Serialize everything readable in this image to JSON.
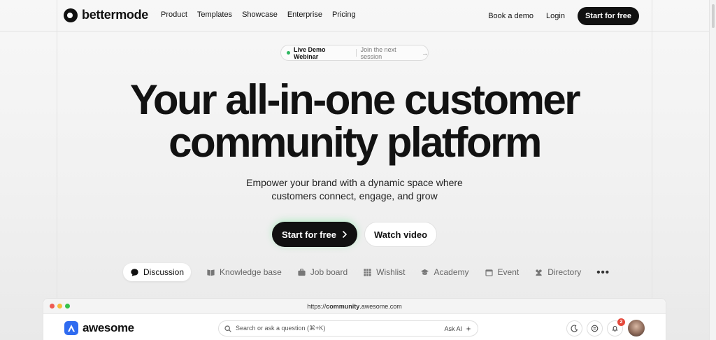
{
  "header": {
    "brand": "bettermode",
    "nav": [
      "Product",
      "Templates",
      "Showcase",
      "Enterprise",
      "Pricing"
    ],
    "book_demo": "Book a demo",
    "login": "Login",
    "start_free": "Start for free"
  },
  "webinar": {
    "label": "Live Demo Webinar",
    "link": "Join the next session",
    "arrow": "→"
  },
  "hero": {
    "title_line1": "Your all-in-one customer",
    "title_line2": "community platform",
    "subtitle_line1": "Empower your brand with a dynamic space where",
    "subtitle_line2": "customers connect, engage, and grow",
    "cta_primary": "Start for free",
    "cta_secondary": "Watch video"
  },
  "tabs": [
    {
      "label": "Discussion",
      "icon": "chat-bubble-icon",
      "active": true
    },
    {
      "label": "Knowledge base",
      "icon": "book-icon",
      "active": false
    },
    {
      "label": "Job board",
      "icon": "briefcase-icon",
      "active": false
    },
    {
      "label": "Wishlist",
      "icon": "grid-icon",
      "active": false
    },
    {
      "label": "Academy",
      "icon": "graduation-cap-icon",
      "active": false
    },
    {
      "label": "Event",
      "icon": "calendar-icon",
      "active": false
    },
    {
      "label": "Directory",
      "icon": "people-icon",
      "active": false
    }
  ],
  "more_label": "•••",
  "preview": {
    "url_prefix": "https://",
    "url_host": "community",
    "url_suffix": ".awesome.com",
    "app_name": "awesome",
    "search_placeholder": "Search or ask a question (⌘+K)",
    "ask_ai": "Ask AI",
    "notifications_count": "2"
  },
  "colors": {
    "accent_green": "#2db660",
    "brand_blue": "#2f6bf0",
    "badge_red": "#e5483b",
    "traffic_red": "#ee5b52",
    "traffic_yellow": "#f5bd3b",
    "traffic_green": "#35c24a"
  }
}
